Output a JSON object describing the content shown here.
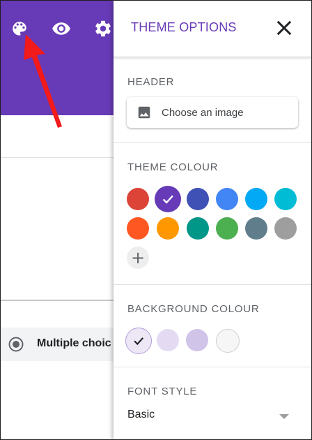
{
  "toolbar": {
    "palette_icon": "palette-icon",
    "preview_icon": "eye-icon",
    "settings_icon": "gear-icon",
    "header_color": "#673ab7"
  },
  "form": {
    "question_type": "Multiple choic",
    "question_icon": "radio-button-checked-icon"
  },
  "annotation": {
    "arrow_color": "#f21a1a"
  },
  "panel": {
    "title": "THEME OPTIONS",
    "close_icon": "close-icon",
    "header_section": {
      "title": "HEADER",
      "button_label": "Choose an image",
      "button_icon": "image-icon"
    },
    "theme_colour": {
      "title": "THEME COLOUR",
      "selected": "#673ab7",
      "colors": [
        "#db4437",
        "#673ab7",
        "#3f51b5",
        "#4285f4",
        "#03a9f4",
        "#00bcd4",
        "#ff5722",
        "#ff9800",
        "#009688",
        "#4caf50",
        "#607d8b",
        "#9e9e9e"
      ],
      "add_icon": "+"
    },
    "background_colour": {
      "title": "BACKGROUND COLOUR",
      "selected": "#ede7f6",
      "colors": [
        "#ede7f6",
        "#e4dbf3",
        "#d1c4e9",
        "#f6f6f6"
      ]
    },
    "font_style": {
      "title": "FONT STYLE",
      "value": "Basic"
    }
  }
}
